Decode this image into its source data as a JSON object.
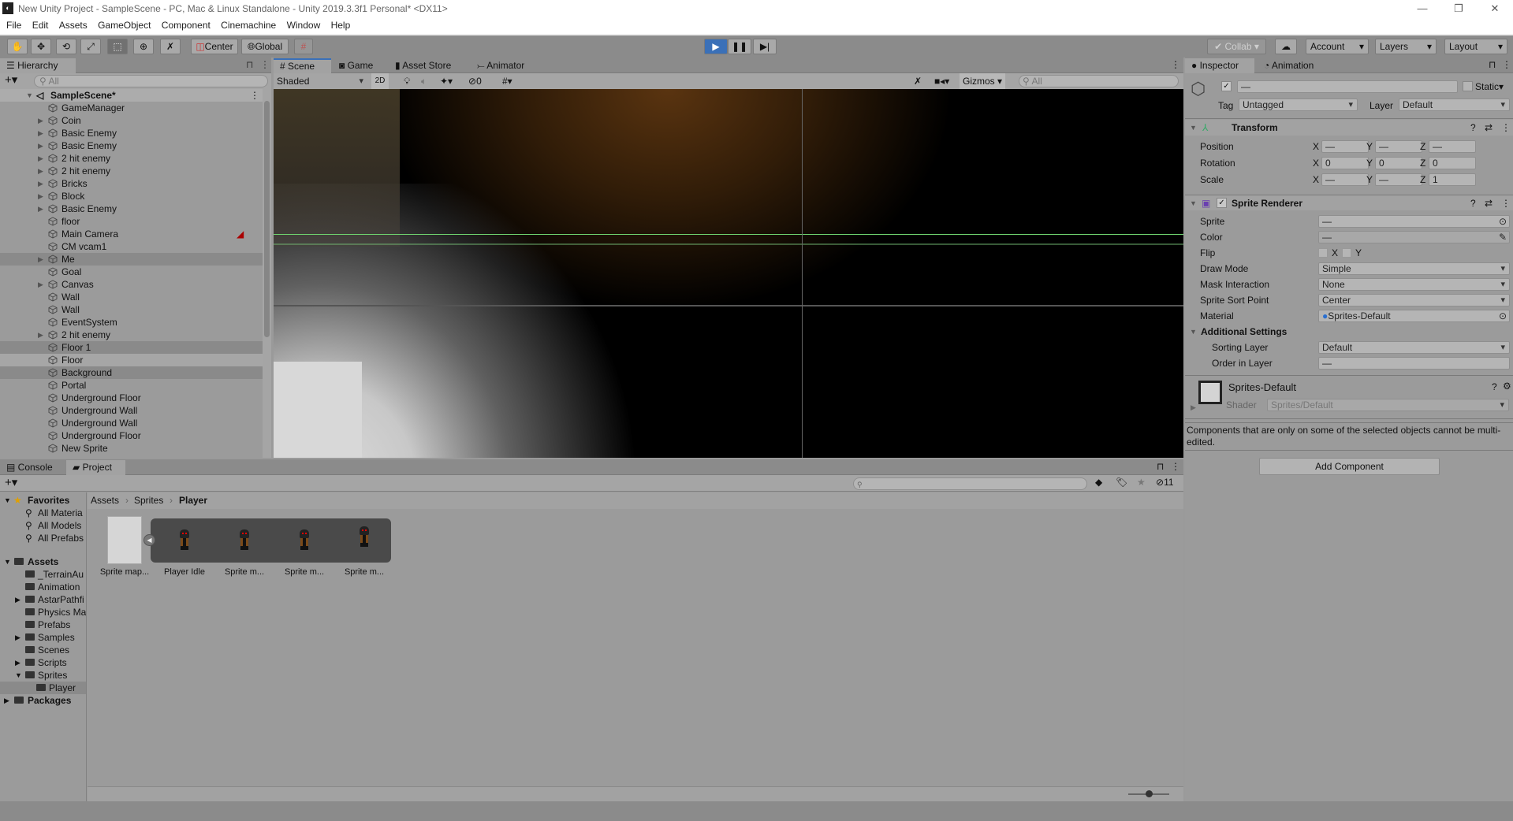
{
  "window": {
    "title": "New Unity Project - SampleScene - PC, Mac & Linux Standalone - Unity 2019.3.3f1 Personal* <DX11>"
  },
  "menu": [
    "File",
    "Edit",
    "Assets",
    "GameObject",
    "Component",
    "Cinemachine",
    "Window",
    "Help"
  ],
  "toolbar": {
    "tools": [
      "hand-icon",
      "move-icon",
      "rotate-icon",
      "scale-icon",
      "rect-icon",
      "transform-icon",
      "custom-tool-icon"
    ],
    "pivot": "Center",
    "space": "Global",
    "collab": "Collab",
    "account": "Account",
    "layers": "Layers",
    "layout": "Layout",
    "play_mode_active": true
  },
  "hierarchy": {
    "tab": "Hierarchy",
    "search_placeholder": "All",
    "scene": "SampleScene*",
    "items": [
      {
        "label": "GameManager",
        "expandable": false
      },
      {
        "label": "Coin",
        "expandable": true
      },
      {
        "label": "Basic Enemy",
        "expandable": true
      },
      {
        "label": "Basic Enemy",
        "expandable": true
      },
      {
        "label": "2 hit enemy",
        "expandable": true
      },
      {
        "label": "2 hit enemy",
        "expandable": true
      },
      {
        "label": "Bricks",
        "expandable": true
      },
      {
        "label": "Block",
        "expandable": true
      },
      {
        "label": "Basic Enemy",
        "expandable": true
      },
      {
        "label": "floor",
        "expandable": false
      },
      {
        "label": "Main Camera",
        "expandable": false
      },
      {
        "label": "CM vcam1",
        "expandable": false
      },
      {
        "label": "Me",
        "expandable": true,
        "selected": true
      },
      {
        "label": "Goal",
        "expandable": false
      },
      {
        "label": "Canvas",
        "expandable": true
      },
      {
        "label": "Wall",
        "expandable": false
      },
      {
        "label": "Wall",
        "expandable": false
      },
      {
        "label": "EventSystem",
        "expandable": false
      },
      {
        "label": "2 hit enemy",
        "expandable": true
      },
      {
        "label": "Floor 1",
        "expandable": false,
        "selected": true
      },
      {
        "label": "Floor",
        "expandable": false
      },
      {
        "label": "Background",
        "expandable": false,
        "selected": true
      },
      {
        "label": "Portal",
        "expandable": false
      },
      {
        "label": "Underground Floor",
        "expandable": false
      },
      {
        "label": "Underground Wall",
        "expandable": false
      },
      {
        "label": "Underground Wall",
        "expandable": false
      },
      {
        "label": "Underground Floor",
        "expandable": false
      },
      {
        "label": "New Sprite",
        "expandable": false
      }
    ]
  },
  "scene_view": {
    "tabs": [
      "Scene",
      "Game",
      "Asset Store",
      "Animator"
    ],
    "active_tab": "Scene",
    "shading": "Shaded",
    "mode_2d": "2D",
    "hidden_count": "0",
    "gizmos": "Gizmos",
    "search_placeholder": "All"
  },
  "inspector": {
    "tabs": [
      "Inspector",
      "Animation"
    ],
    "object_name": "—",
    "static_label": "Static",
    "tag_label": "Tag",
    "tag": "Untagged",
    "layer_label": "Layer",
    "layer": "Default",
    "transform": {
      "title": "Transform",
      "rows": [
        {
          "label": "Position",
          "x": "—",
          "y": "—",
          "z": "—"
        },
        {
          "label": "Rotation",
          "x": "0",
          "y": "0",
          "z": "0"
        },
        {
          "label": "Scale",
          "x": "—",
          "y": "—",
          "z": "1"
        }
      ]
    },
    "sprite_renderer": {
      "title": "Sprite Renderer",
      "sprite_label": "Sprite",
      "sprite": "—",
      "color_label": "Color",
      "color": "—",
      "flip_label": "Flip",
      "flip_x": "X",
      "flip_y": "Y",
      "draw_mode_label": "Draw Mode",
      "draw_mode": "Simple",
      "mask_label": "Mask Interaction",
      "mask": "None",
      "sort_point_label": "Sprite Sort Point",
      "sort_point": "Center",
      "material_label": "Material",
      "material": "Sprites-Default",
      "additional_label": "Additional Settings",
      "sorting_layer_label": "Sorting Layer",
      "sorting_layer": "Default",
      "order_label": "Order in Layer",
      "order": "—"
    },
    "material": {
      "name": "Sprites-Default",
      "shader_label": "Shader",
      "shader": "Sprites/Default"
    },
    "message": "Components that are only on some of the selected objects cannot be multi-edited.",
    "add_component": "Add Component"
  },
  "bottom": {
    "tabs": [
      "Console",
      "Project"
    ],
    "active_tab": "Project",
    "hidden_count": "11",
    "favorites": {
      "label": "Favorites",
      "items": [
        "All Materia",
        "All Models",
        "All Prefabs"
      ]
    },
    "assets": {
      "label": "Assets",
      "items": [
        {
          "label": "_TerrainAu",
          "expandable": false
        },
        {
          "label": "Animation",
          "expandable": false
        },
        {
          "label": "AstarPathfi",
          "expandable": true
        },
        {
          "label": "Physics Ma",
          "expandable": false
        },
        {
          "label": "Prefabs",
          "expandable": false
        },
        {
          "label": "Samples",
          "expandable": true
        },
        {
          "label": "Scenes",
          "expandable": false
        },
        {
          "label": "Scripts",
          "expandable": true
        },
        {
          "label": "Sprites",
          "expandable": true,
          "expanded": true
        },
        {
          "label": "Player",
          "expandable": false,
          "selected": true
        }
      ]
    },
    "packages": "Packages",
    "breadcrumb": [
      "Assets",
      "Sprites",
      "Player"
    ],
    "files": [
      "Sprite map...",
      "Player Idle",
      "Sprite m...",
      "Sprite m...",
      "Sprite m..."
    ],
    "thumbnail_zoom": 0.5
  },
  "colors": {
    "accent": "#3a70b8",
    "grid_green": "#6fd46f"
  }
}
